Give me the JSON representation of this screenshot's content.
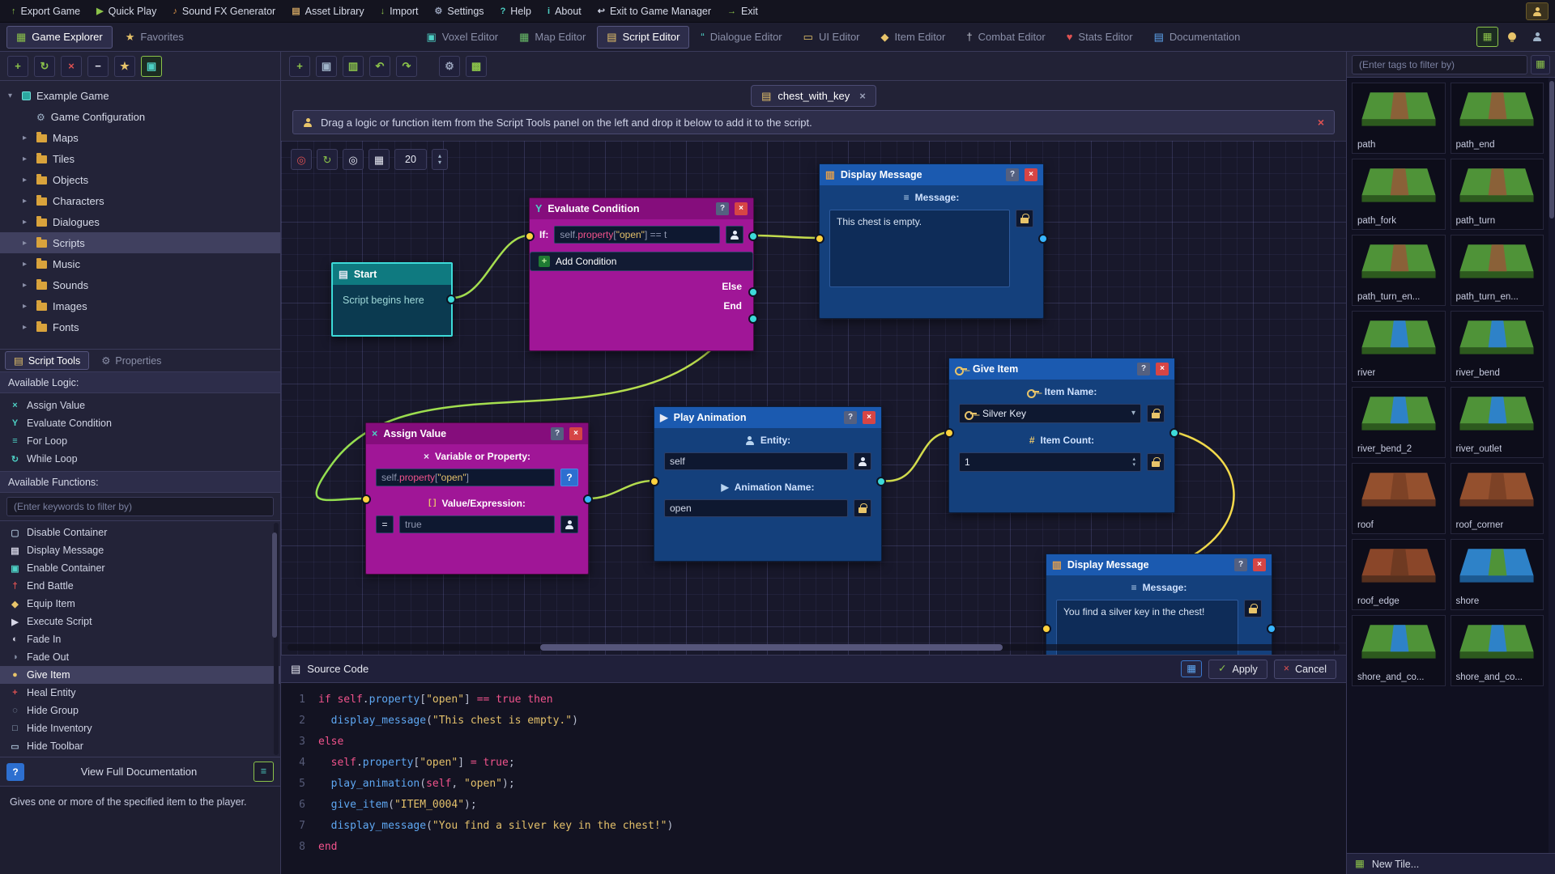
{
  "menubar": {
    "items": [
      {
        "label": "Export Game",
        "glyph": "↑",
        "c": "#8bc34a"
      },
      {
        "label": "Quick Play",
        "glyph": "▶",
        "c": "#8bc34a"
      },
      {
        "label": "Sound FX Generator",
        "glyph": "♪",
        "c": "#e0974a"
      },
      {
        "label": "Asset Library",
        "glyph": "▤",
        "c": "#c99f5f"
      },
      {
        "label": "Import",
        "glyph": "↓",
        "c": "#8bc34a"
      },
      {
        "label": "Settings",
        "glyph": "⚙",
        "c": "#9aa4bc"
      },
      {
        "label": "Help",
        "glyph": "?",
        "c": "#4dd0c4"
      },
      {
        "label": "About",
        "glyph": "i",
        "c": "#4dd0c4"
      },
      {
        "label": "Exit to Game Manager",
        "glyph": "↩",
        "c": "#cfd4e4"
      },
      {
        "label": "Exit",
        "glyph": "→",
        "c": "#8bc34a"
      }
    ]
  },
  "tabbar": {
    "panel_tabs": [
      {
        "label": "Game Explorer",
        "glyph": "▦",
        "c": "#8bc34a",
        "active": true
      },
      {
        "label": "Favorites",
        "glyph": "★",
        "c": "#e8c46a"
      }
    ],
    "editor_tabs": [
      {
        "label": "Voxel Editor",
        "glyph": "▣",
        "c": "#4dd0c4"
      },
      {
        "label": "Map Editor",
        "glyph": "▦",
        "c": "#6abf69"
      },
      {
        "label": "Script Editor",
        "glyph": "▤",
        "c": "#e8c46a",
        "active": true
      },
      {
        "label": "Dialogue Editor",
        "glyph": "“",
        "c": "#4dd0c4"
      },
      {
        "label": "UI Editor",
        "glyph": "▭",
        "c": "#e8c46a"
      },
      {
        "label": "Item Editor",
        "glyph": "◆",
        "c": "#e8c46a"
      },
      {
        "label": "Combat Editor",
        "glyph": "†",
        "c": "#c8ccd8"
      },
      {
        "label": "Stats Editor",
        "glyph": "♥",
        "c": "#e05252"
      },
      {
        "label": "Documentation",
        "glyph": "▤",
        "c": "#5ea7f2"
      }
    ]
  },
  "explorer": {
    "tree": [
      {
        "chev": "▾",
        "icon": "ic-cube",
        "label": "Example Game",
        "d": "d0"
      },
      {
        "chev": "",
        "icon": "ic-gear",
        "label": "Game Configuration",
        "d": "d1"
      },
      {
        "chev": "▸",
        "icon": "ic-folder",
        "label": "Maps",
        "d": "d1"
      },
      {
        "chev": "▸",
        "icon": "ic-folder",
        "label": "Tiles",
        "d": "d1"
      },
      {
        "chev": "▸",
        "icon": "ic-folder",
        "label": "Objects",
        "d": "d1"
      },
      {
        "chev": "▸",
        "icon": "ic-folder",
        "label": "Characters",
        "d": "d1"
      },
      {
        "chev": "▸",
        "icon": "ic-folder",
        "label": "Dialogues",
        "d": "d1"
      },
      {
        "chev": "▸",
        "icon": "ic-folder",
        "label": "Scripts",
        "d": "d1",
        "selected": true
      },
      {
        "chev": "▸",
        "icon": "ic-folder",
        "label": "Music",
        "d": "d1"
      },
      {
        "chev": "▸",
        "icon": "ic-folder",
        "label": "Sounds",
        "d": "d1"
      },
      {
        "chev": "▸",
        "icon": "ic-folder",
        "label": "Images",
        "d": "d1"
      },
      {
        "chev": "▸",
        "icon": "ic-folder",
        "label": "Fonts",
        "d": "d1"
      }
    ]
  },
  "tools": {
    "tabs": [
      {
        "label": "Script Tools",
        "glyph": "▤",
        "c": "#e8c46a",
        "active": true
      },
      {
        "label": "Properties",
        "glyph": "⚙",
        "c": "#8a8fa8"
      }
    ],
    "logic_header": "Available Logic:",
    "logic": [
      {
        "glyph": "×",
        "c": "#4dd0c4",
        "label": "Assign Value"
      },
      {
        "glyph": "Y",
        "c": "#4dd0c4",
        "label": "Evaluate Condition"
      },
      {
        "glyph": "≡",
        "c": "#4dd0c4",
        "label": "For Loop"
      },
      {
        "glyph": "↻",
        "c": "#4dd0c4",
        "label": "While Loop"
      }
    ],
    "functions_header": "Available Functions:",
    "filter_placeholder": "(Enter keywords to filter by)",
    "functions": [
      {
        "glyph": "▢",
        "c": "#9fb3c8",
        "label": "Disable Container"
      },
      {
        "glyph": "▤",
        "c": "#d8d8e8",
        "label": "Display Message"
      },
      {
        "glyph": "▣",
        "c": "#4dd0c4",
        "label": "Enable Container"
      },
      {
        "glyph": "†",
        "c": "#e05252",
        "label": "End Battle"
      },
      {
        "glyph": "◆",
        "c": "#e8c46a",
        "label": "Equip Item"
      },
      {
        "glyph": "▶",
        "c": "#d8d8e8",
        "label": "Execute Script"
      },
      {
        "glyph": "◐",
        "c": "#d8d8e8",
        "label": "Fade In"
      },
      {
        "glyph": "◑",
        "c": "#8892a8",
        "label": "Fade Out"
      },
      {
        "glyph": "●",
        "c": "#e8c46a",
        "label": "Give Item",
        "selected": true
      },
      {
        "glyph": "+",
        "c": "#e05252",
        "label": "Heal Entity"
      },
      {
        "glyph": "◌",
        "c": "#9fb3c8",
        "label": "Hide Group"
      },
      {
        "glyph": "□",
        "c": "#9fb3c8",
        "label": "Hide Inventory"
      },
      {
        "glyph": "▭",
        "c": "#9fb3c8",
        "label": "Hide Toolbar"
      }
    ],
    "doc_link": "View Full Documentation",
    "description": "Gives one or more of the specified item to the player."
  },
  "script_editor": {
    "tab": {
      "label": "chest_with_key"
    },
    "hint": "Drag a logic or function item from the Script Tools panel on the left and drop it below to add it to the script.",
    "grid_size": "20",
    "nodes": {
      "start": {
        "title": "Start",
        "body": "Script begins here"
      },
      "evaluate": {
        "title": "Evaluate Condition",
        "if_label": "If:",
        "condition_segs": [
          {
            "t": "self.",
            "c": "p2"
          },
          {
            "t": "property",
            "c": "kw"
          },
          {
            "t": "[",
            "c": "p2"
          },
          {
            "t": "\"open\"",
            "c": "str"
          },
          {
            "t": "] == t",
            "c": "p2"
          }
        ],
        "add_btn": "Add Condition",
        "else_label": "Else",
        "end_label": "End"
      },
      "message1": {
        "title": "Display Message",
        "label": "Message:",
        "text": "This chest is empty."
      },
      "assign": {
        "title": "Assign Value",
        "var_label": "Variable or Property:",
        "variable_segs": [
          {
            "t": "self.",
            "c": "p2"
          },
          {
            "t": "property",
            "c": "kw"
          },
          {
            "t": "[",
            "c": "p2"
          },
          {
            "t": "\"open\"",
            "c": "str"
          },
          {
            "t": "]",
            "c": "p2"
          }
        ],
        "val_label": "Value/Expression:",
        "op": "=",
        "value": "true"
      },
      "anim": {
        "title": "Play Animation",
        "entity_label": "Entity:",
        "entity": "self",
        "name_label": "Animation Name:",
        "anim": "open"
      },
      "give": {
        "title": "Give Item",
        "item_label": "Item Name:",
        "item": "Silver Key",
        "count_label": "Item Count:",
        "count": "1"
      },
      "message2": {
        "title": "Display Message",
        "label": "Message:",
        "text": "You find a silver key in the chest!"
      }
    }
  },
  "source": {
    "title": "Source Code",
    "apply": "Apply",
    "cancel": "Cancel",
    "lines": [
      {
        "n": "1",
        "segs": [
          {
            "t": "if ",
            "c": "kw"
          },
          {
            "t": "self",
            "c": "kw"
          },
          {
            "t": ".",
            "c": "p"
          },
          {
            "t": "property",
            "c": "fn"
          },
          {
            "t": "[",
            "c": "p"
          },
          {
            "t": "\"open\"",
            "c": "str"
          },
          {
            "t": "]",
            "c": "p"
          },
          {
            "t": " == ",
            "c": "kw"
          },
          {
            "t": "true",
            "c": "kw"
          },
          {
            "t": " then",
            "c": "kw"
          }
        ]
      },
      {
        "n": "2",
        "segs": [
          {
            "t": "  ",
            "c": "p"
          },
          {
            "t": "display_message",
            "c": "fn"
          },
          {
            "t": "(",
            "c": "p"
          },
          {
            "t": "\"This chest is empty.\"",
            "c": "str"
          },
          {
            "t": ")",
            "c": "p"
          }
        ]
      },
      {
        "n": "3",
        "segs": [
          {
            "t": "else",
            "c": "kw"
          }
        ]
      },
      {
        "n": "4",
        "segs": [
          {
            "t": "  ",
            "c": "p"
          },
          {
            "t": "self",
            "c": "kw"
          },
          {
            "t": ".",
            "c": "p"
          },
          {
            "t": "property",
            "c": "fn"
          },
          {
            "t": "[",
            "c": "p"
          },
          {
            "t": "\"open\"",
            "c": "str"
          },
          {
            "t": "]",
            "c": "p"
          },
          {
            "t": " = ",
            "c": "kw"
          },
          {
            "t": "true",
            "c": "kw"
          },
          {
            "t": ";",
            "c": "p"
          }
        ]
      },
      {
        "n": "5",
        "segs": [
          {
            "t": "  ",
            "c": "p"
          },
          {
            "t": "play_animation",
            "c": "fn"
          },
          {
            "t": "(",
            "c": "p"
          },
          {
            "t": "self",
            "c": "kw"
          },
          {
            "t": ", ",
            "c": "p"
          },
          {
            "t": "\"open\"",
            "c": "str"
          },
          {
            "t": ")",
            "c": "p"
          },
          {
            "t": ";",
            "c": "p"
          }
        ]
      },
      {
        "n": "6",
        "segs": [
          {
            "t": "  ",
            "c": "p"
          },
          {
            "t": "give_item",
            "c": "fn"
          },
          {
            "t": "(",
            "c": "p"
          },
          {
            "t": "\"ITEM_0004\"",
            "c": "str"
          },
          {
            "t": ")",
            "c": "p"
          },
          {
            "t": ";",
            "c": "p"
          }
        ]
      },
      {
        "n": "7",
        "segs": [
          {
            "t": "  ",
            "c": "p"
          },
          {
            "t": "display_message",
            "c": "fn"
          },
          {
            "t": "(",
            "c": "p"
          },
          {
            "t": "\"You find a silver key in the chest!\"",
            "c": "str"
          },
          {
            "t": ")",
            "c": "p"
          }
        ]
      },
      {
        "n": "8",
        "segs": [
          {
            "t": "end",
            "c": "kw"
          }
        ]
      }
    ]
  },
  "tiles_panel": {
    "filter_placeholder": "(Enter tags to filter by)",
    "tiles": [
      {
        "name": "path",
        "top": "#4f9338",
        "front": "#2d5a1e",
        "accent": "#8a6138"
      },
      {
        "name": "path_end",
        "top": "#4f9338",
        "front": "#2d5a1e",
        "accent": "#8a6138"
      },
      {
        "name": "path_fork",
        "top": "#4f9338",
        "front": "#2d5a1e",
        "accent": "#8a6138"
      },
      {
        "name": "path_turn",
        "top": "#4f9338",
        "front": "#2d5a1e",
        "accent": "#8a6138"
      },
      {
        "name": "path_turn_en...",
        "top": "#4f9338",
        "front": "#2d5a1e",
        "accent": "#8a6138"
      },
      {
        "name": "path_turn_en...",
        "top": "#4f9338",
        "front": "#2d5a1e",
        "accent": "#8a6138"
      },
      {
        "name": "river",
        "top": "#4f9338",
        "front": "#2d5a1e",
        "accent": "#2e82c8"
      },
      {
        "name": "river_bend",
        "top": "#4f9338",
        "front": "#2d5a1e",
        "accent": "#2e82c8"
      },
      {
        "name": "river_bend_2",
        "top": "#4f9338",
        "front": "#2d5a1e",
        "accent": "#2e82c8"
      },
      {
        "name": "river_outlet",
        "top": "#4f9338",
        "front": "#2d5a1e",
        "accent": "#2e82c8"
      },
      {
        "name": "roof",
        "top": "#94502e",
        "front": "#5f3220",
        "accent": "#7d4226"
      },
      {
        "name": "roof_corner",
        "top": "#94502e",
        "front": "#5f3220",
        "accent": "#7d4226"
      },
      {
        "name": "roof_edge",
        "top": "#8a4629",
        "front": "#56301e",
        "accent": "#6f3a22"
      },
      {
        "name": "shore",
        "top": "#2e82c8",
        "front": "#1c5a92",
        "accent": "#4f9338"
      },
      {
        "name": "shore_and_co...",
        "top": "#4f9338",
        "front": "#2d5a1e",
        "accent": "#2e82c8"
      },
      {
        "name": "shore_and_co...",
        "top": "#4f9338",
        "front": "#2d5a1e",
        "accent": "#2e82c8"
      }
    ],
    "new_tile": "New Tile..."
  }
}
